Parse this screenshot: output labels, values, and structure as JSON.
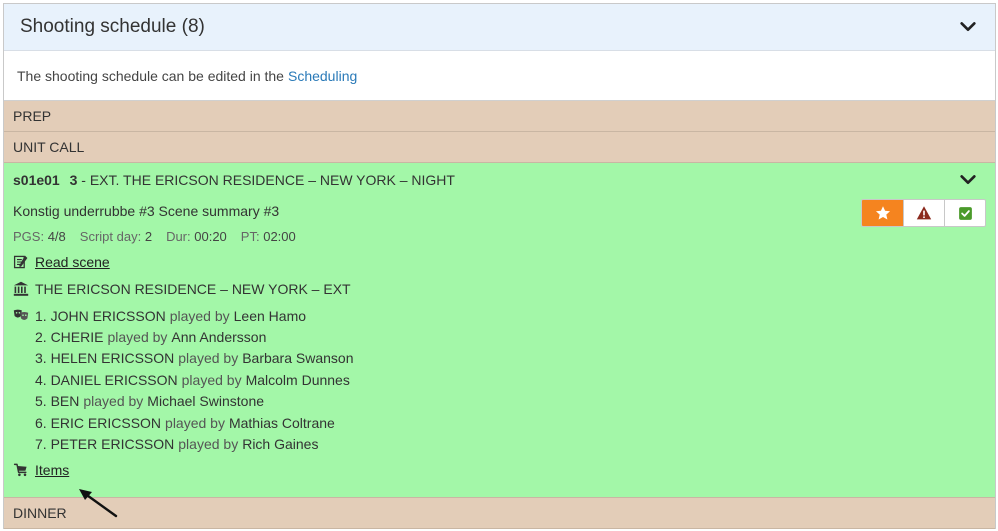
{
  "header": {
    "title": "Shooting schedule (8)"
  },
  "info": {
    "text": "The shooting schedule can be edited in the",
    "link": "Scheduling"
  },
  "banners": {
    "prep": "PREP",
    "unit_call": "UNIT CALL",
    "dinner": "DINNER"
  },
  "scene": {
    "episode": "s01e01",
    "number": "3",
    "heading": "- EXT. THE ERICSON RESIDENCE – NEW YORK – NIGHT",
    "summary": "Konstig underrubbe #3 Scene summary #3",
    "meta": {
      "pgs_label": "PGS:",
      "pgs": "4/8",
      "script_day_label": "Script day:",
      "script_day": "2",
      "dur_label": "Dur:",
      "dur": "00:20",
      "pt_label": "PT:",
      "pt": "02:00"
    },
    "read_scene": "Read scene",
    "location": "THE ERICSON RESIDENCE – NEW YORK – EXT",
    "played_by": "played by",
    "cast": [
      {
        "role": "1. JOHN ERICSSON",
        "actor": "Leen Hamo"
      },
      {
        "role": "2. CHERIE",
        "actor": "Ann Andersson"
      },
      {
        "role": "3. HELEN ERICSSON",
        "actor": "Barbara Swanson"
      },
      {
        "role": "4. DANIEL ERICSSON",
        "actor": "Malcolm Dunnes"
      },
      {
        "role": "5. BEN",
        "actor": "Michael Swinstone"
      },
      {
        "role": "6. ERIC ERICSSON",
        "actor": "Mathias Coltrane"
      },
      {
        "role": "7. PETER ERICSSON",
        "actor": "Rich Gaines"
      }
    ],
    "items": "Items"
  },
  "colors": {
    "header_bg": "#e8f2fc",
    "banner_bg": "#e3cdb8",
    "scene_bg": "#a3f7a8",
    "link": "#2a7ab8",
    "star_badge": "#f5841f",
    "warning_icon": "#8b2a1e",
    "check_icon": "#4a9a2a"
  },
  "icons": {
    "header_toggle": "chevron-down-icon",
    "scene_toggle": "chevron-down-icon",
    "read_scene": "script-icon",
    "location": "building-icon",
    "cast": "theater-masks-icon",
    "items": "cart-icon",
    "badges": [
      "star-icon",
      "warning-icon",
      "check-icon"
    ]
  }
}
